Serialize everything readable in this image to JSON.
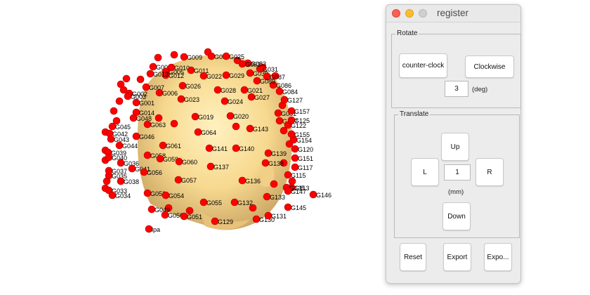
{
  "window": {
    "title": "register"
  },
  "rotate": {
    "title": "Rotate",
    "counter_label": "counter-clock",
    "clockwise_label": "Clockwise",
    "angle_value": "3",
    "angle_unit": "(deg)"
  },
  "translate": {
    "title": "Translate",
    "up_label": "Up",
    "down_label": "Down",
    "left_label": "L",
    "right_label": "R",
    "step_value": "1",
    "step_unit": "(mm)"
  },
  "actions": {
    "reset_label": "Reset",
    "export_label": "Export",
    "export2_label": "Expo..."
  },
  "plot": {
    "head_color": "#f7d98f",
    "electrode_color": "#ff0000",
    "electrodes": [
      {
        "name": "G001"
      },
      {
        "name": "G002"
      },
      {
        "name": "G003"
      },
      {
        "name": "G004"
      },
      {
        "name": "G005"
      },
      {
        "name": "G006"
      },
      {
        "name": "G007"
      },
      {
        "name": "G009"
      },
      {
        "name": "G010"
      },
      {
        "name": "G011"
      },
      {
        "name": "G012"
      },
      {
        "name": "G013"
      },
      {
        "name": "G014"
      },
      {
        "name": "G017"
      },
      {
        "name": "G019"
      },
      {
        "name": "G020"
      },
      {
        "name": "G021"
      },
      {
        "name": "G022"
      },
      {
        "name": "G023"
      },
      {
        "name": "G024"
      },
      {
        "name": "G025"
      },
      {
        "name": "G026"
      },
      {
        "name": "G027"
      },
      {
        "name": "G028"
      },
      {
        "name": "G029"
      },
      {
        "name": "G030"
      },
      {
        "name": "G031"
      },
      {
        "name": "G033"
      },
      {
        "name": "G034"
      },
      {
        "name": "G035"
      },
      {
        "name": "G036"
      },
      {
        "name": "G037"
      },
      {
        "name": "G038"
      },
      {
        "name": "G039"
      },
      {
        "name": "G040"
      },
      {
        "name": "G041"
      },
      {
        "name": "G042"
      },
      {
        "name": "G043"
      },
      {
        "name": "G044"
      },
      {
        "name": "G045"
      },
      {
        "name": "G046"
      },
      {
        "name": "G048"
      },
      {
        "name": "G049"
      },
      {
        "name": "G050"
      },
      {
        "name": "G051"
      },
      {
        "name": "G053"
      },
      {
        "name": "G054"
      },
      {
        "name": "G055"
      },
      {
        "name": "G056"
      },
      {
        "name": "G057"
      },
      {
        "name": "G058"
      },
      {
        "name": "G059"
      },
      {
        "name": "G060"
      },
      {
        "name": "G061"
      },
      {
        "name": "G063"
      },
      {
        "name": "G064"
      },
      {
        "name": "G081"
      },
      {
        "name": "G083"
      },
      {
        "name": "G084"
      },
      {
        "name": "G086"
      },
      {
        "name": "G087"
      },
      {
        "name": "G089"
      },
      {
        "name": "G093"
      },
      {
        "name": "G107"
      },
      {
        "name": "G113"
      },
      {
        "name": "G115"
      },
      {
        "name": "G117"
      },
      {
        "name": "G120"
      },
      {
        "name": "G122"
      },
      {
        "name": "G125"
      },
      {
        "name": "G127"
      },
      {
        "name": "G129"
      },
      {
        "name": "G130"
      },
      {
        "name": "G131"
      },
      {
        "name": "G132"
      },
      {
        "name": "G133"
      },
      {
        "name": "G135"
      },
      {
        "name": "G136"
      },
      {
        "name": "G137"
      },
      {
        "name": "G138"
      },
      {
        "name": "G139"
      },
      {
        "name": "G140"
      },
      {
        "name": "G141"
      },
      {
        "name": "G143"
      },
      {
        "name": "G145"
      },
      {
        "name": "G146"
      },
      {
        "name": "G147"
      },
      {
        "name": "G151"
      },
      {
        "name": "G154"
      },
      {
        "name": "G155"
      },
      {
        "name": "G157"
      },
      {
        "name": "lpa"
      }
    ]
  }
}
